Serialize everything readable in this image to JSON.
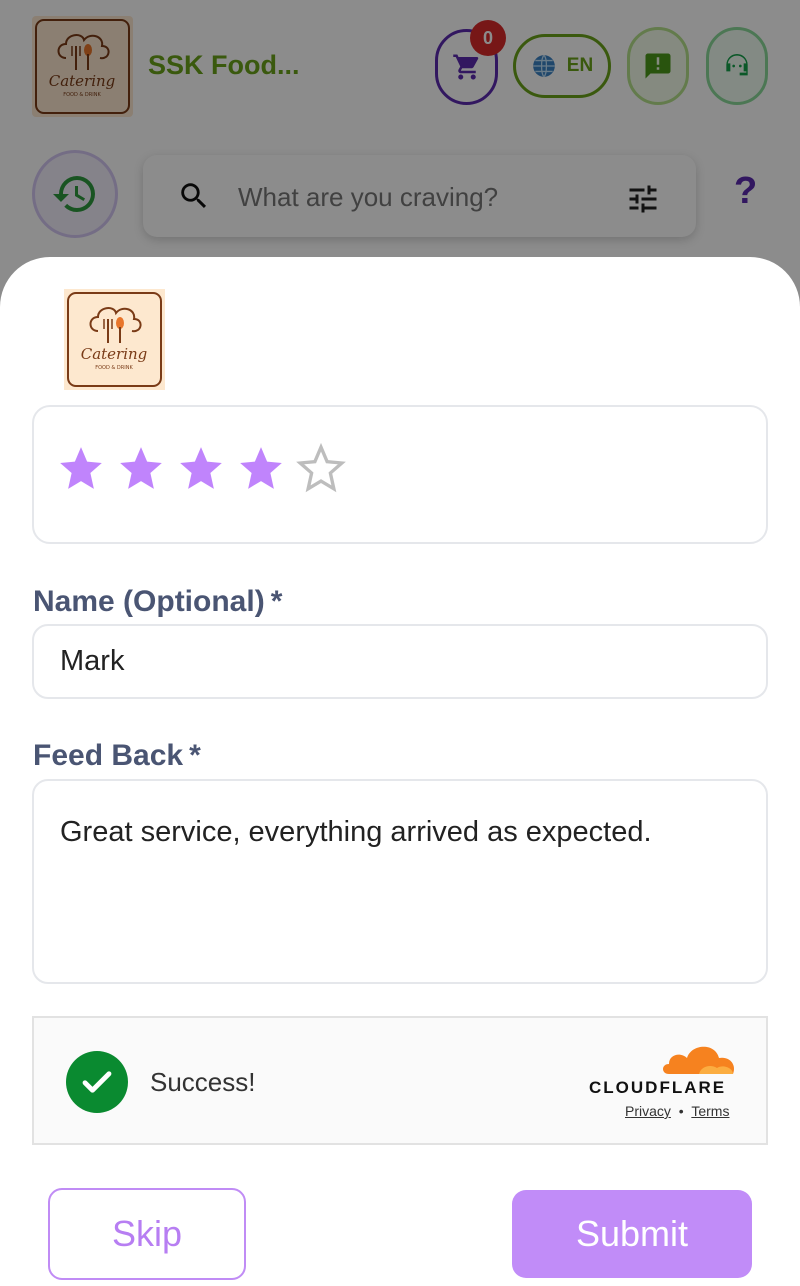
{
  "header": {
    "brand_name": "SSK Food...",
    "cart_count": "0",
    "language": "EN"
  },
  "search": {
    "placeholder": "What are you craving?"
  },
  "help_label": "?",
  "logo": {
    "text": "Catering",
    "subtext": "FOOD & DRINK"
  },
  "rating": {
    "value": 4,
    "max": 5,
    "filled_color": "#c084fc",
    "empty_color": "#bdbdbd"
  },
  "form": {
    "name_label": "Name (Optional)",
    "name_required_mark": "*",
    "name_value": "Mark",
    "feedback_label": "Feed Back",
    "feedback_required_mark": "*",
    "feedback_value": "Great service, everything arrived as expected."
  },
  "captcha": {
    "status": "Success!",
    "provider": "CLOUDFLARE",
    "privacy_link": "Privacy",
    "separator": "•",
    "terms_link": "Terms"
  },
  "actions": {
    "skip_label": "Skip",
    "submit_label": "Submit"
  },
  "colors": {
    "brand_green": "#6aa31a",
    "brand_purple": "#5b2bb0",
    "accent_purple": "#c18cf8",
    "success_green": "#0a8a30",
    "cloudflare_orange": "#f6821f"
  }
}
